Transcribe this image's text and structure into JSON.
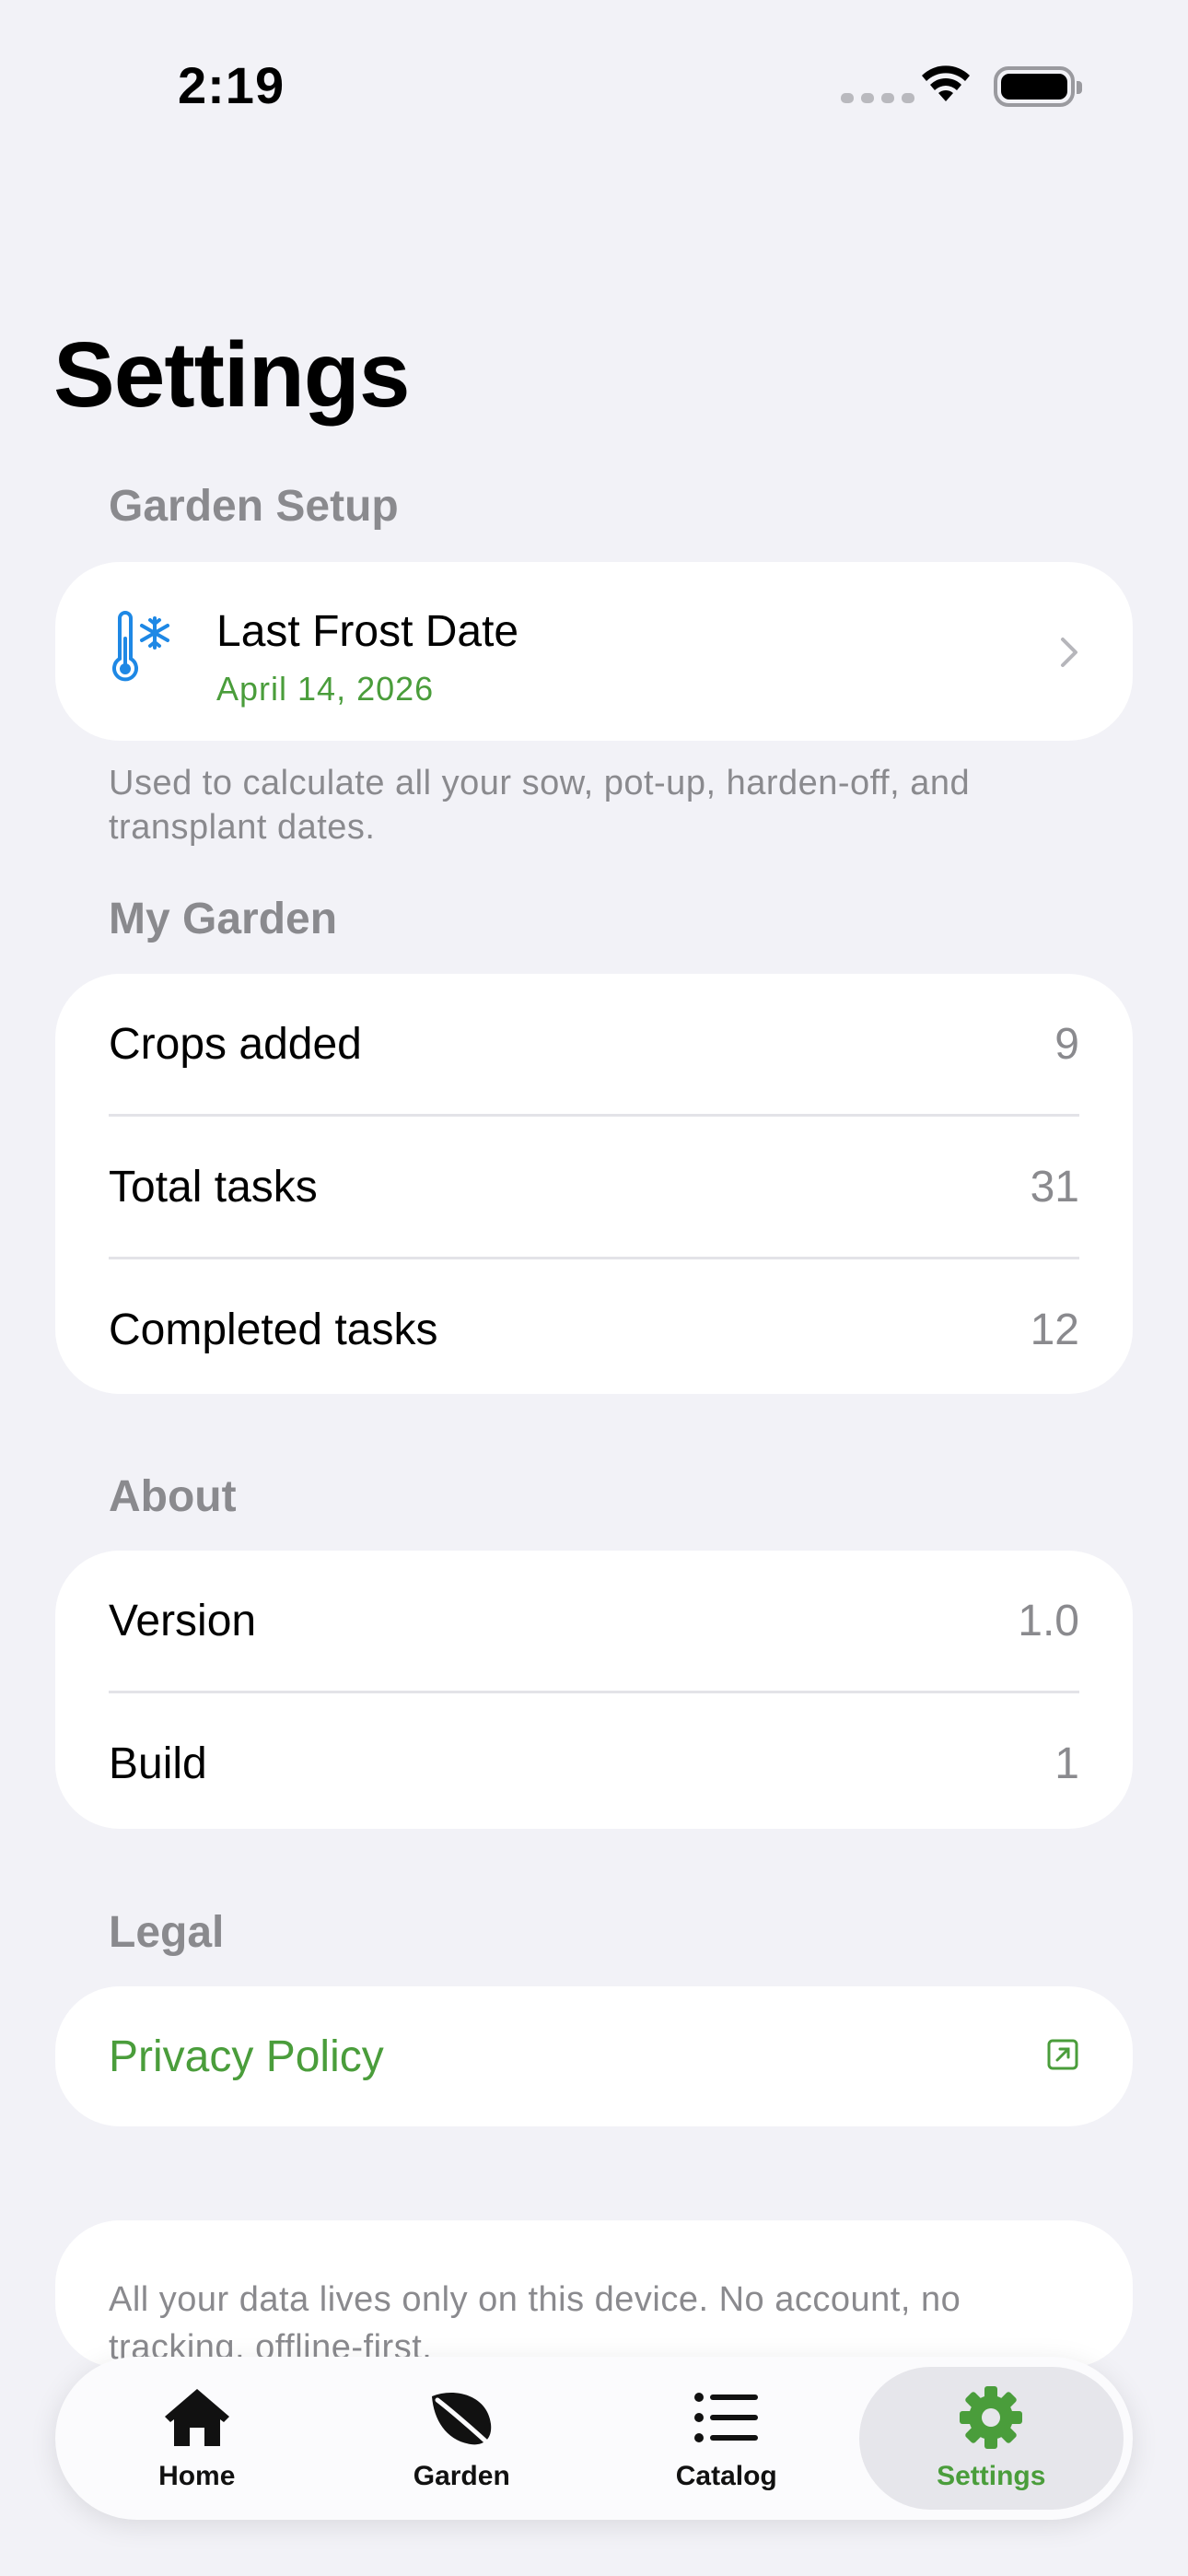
{
  "status_bar": {
    "time": "2:19"
  },
  "page_title": "Settings",
  "garden_setup": {
    "header": "Garden Setup",
    "frost_title": "Last Frost Date",
    "frost_date": "April 14, 2026",
    "footnote": "Used to calculate all your sow, pot-up, harden-off, and transplant dates."
  },
  "my_garden": {
    "header": "My Garden",
    "rows": [
      {
        "label": "Crops added",
        "value": "9"
      },
      {
        "label": "Total tasks",
        "value": "31"
      },
      {
        "label": "Completed tasks",
        "value": "12"
      }
    ]
  },
  "about": {
    "header": "About",
    "rows": [
      {
        "label": "Version",
        "value": "1.0"
      },
      {
        "label": "Build",
        "value": "1"
      }
    ]
  },
  "legal": {
    "header": "Legal",
    "privacy_label": "Privacy Policy"
  },
  "info_note": "All your data lives only on this device. No account, no tracking, offline-first.",
  "tab_bar": {
    "active": "Settings",
    "tabs": [
      {
        "label": "Home",
        "icon": "house-icon"
      },
      {
        "label": "Garden",
        "icon": "leaf-icon"
      },
      {
        "label": "Catalog",
        "icon": "list-icon"
      },
      {
        "label": "Settings",
        "icon": "gear-icon"
      }
    ]
  },
  "colors": {
    "accent": "#4a9d3b",
    "frost_icon": "#1e88e5",
    "background": "#f2f2f7",
    "secondary_text": "#8a8a8e"
  }
}
